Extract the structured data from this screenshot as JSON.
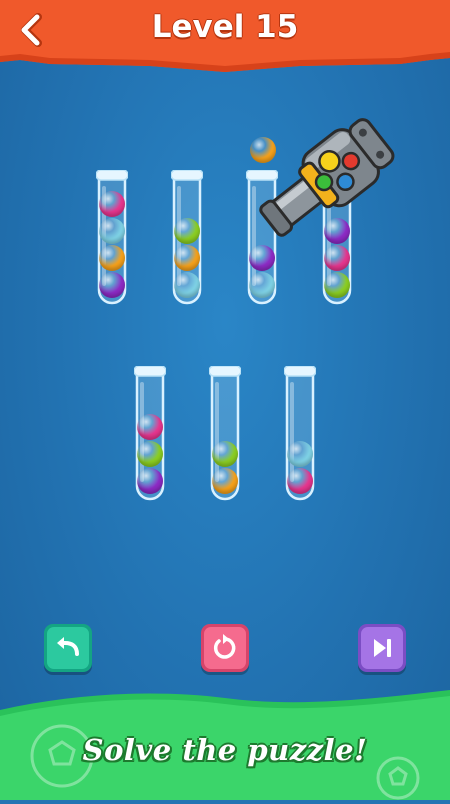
{
  "header": {
    "title": "Level 15",
    "back_icon": "chevron-left-icon",
    "color": "#f0592b"
  },
  "colors": {
    "pink": "#e8368f",
    "teal": "#7fd3e6",
    "orange": "#f7a21b",
    "purple": "#8e2bc6",
    "green": "#8ccf22"
  },
  "tubes": [
    {
      "balls_bottom_to_top": [
        "purple",
        "orange",
        "teal",
        "pink"
      ]
    },
    {
      "balls_bottom_to_top": [
        "teal",
        "orange",
        "green"
      ]
    },
    {
      "balls_bottom_to_top": [
        "teal",
        "purple"
      ]
    },
    {
      "balls_bottom_to_top": [
        "green",
        "pink",
        "purple"
      ]
    },
    {
      "balls_bottom_to_top": [
        "purple",
        "green",
        "pink"
      ]
    },
    {
      "balls_bottom_to_top": [
        "orange",
        "green"
      ]
    },
    {
      "balls_bottom_to_top": [
        "pink",
        "teal"
      ]
    }
  ],
  "launcher": {
    "loaded_ball": "orange",
    "icon": "ball-launcher-icon"
  },
  "controls": {
    "undo_icon": "undo-arrow-icon",
    "restart_icon": "restart-icon",
    "skip_icon": "skip-level-icon"
  },
  "footer": {
    "text": "Solve the puzzle!"
  }
}
